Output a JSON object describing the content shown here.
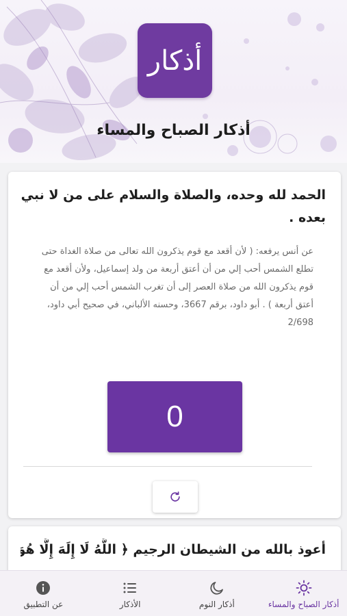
{
  "header": {
    "logo_text": "أذكار",
    "title": "أذكار الصباح والمساء"
  },
  "card1": {
    "dhikr": "الحمد لله وحده، والصلاة والسلام على من لا نبي بعده .",
    "hadith": "عن أنس يرفعه: ( لأن أقعد مع قوم يذكرون الله تعالى من صلاة الغداة حتى تطلع الشمس أحب إلي من أن أعتق أربعة من ولد إسماعيل، ولأن أقعد مع قوم يذكرون الله من صلاة العصر إلى أن تغرب الشمس أحب إلي من أن أعتق أربعة ) . أبو داود، برقم 3667، وحسنه الألباني، في صحيح أبي داود، 2/698",
    "counter": "0"
  },
  "card2": {
    "dhikr": "أعوذ بالله من الشيطان الرجيم ﴿ اللَّهُ لَا إِلَهَ إِلَّا هُوَ الْحَيُّ الْقَيُّومُ"
  },
  "bottom_nav": {
    "items": [
      {
        "label": "أذكار الصباح والمساء",
        "icon": "sun-icon",
        "active": true
      },
      {
        "label": "أذكار النوم",
        "icon": "moon-icon",
        "active": false
      },
      {
        "label": "الأذكار",
        "icon": "list-icon",
        "active": false
      },
      {
        "label": "عن التطبيق",
        "icon": "info-icon",
        "active": false
      }
    ]
  },
  "colors": {
    "accent": "#6a35a2",
    "logo_bg": "#6f3ba0",
    "background": "#f2f2f4"
  }
}
